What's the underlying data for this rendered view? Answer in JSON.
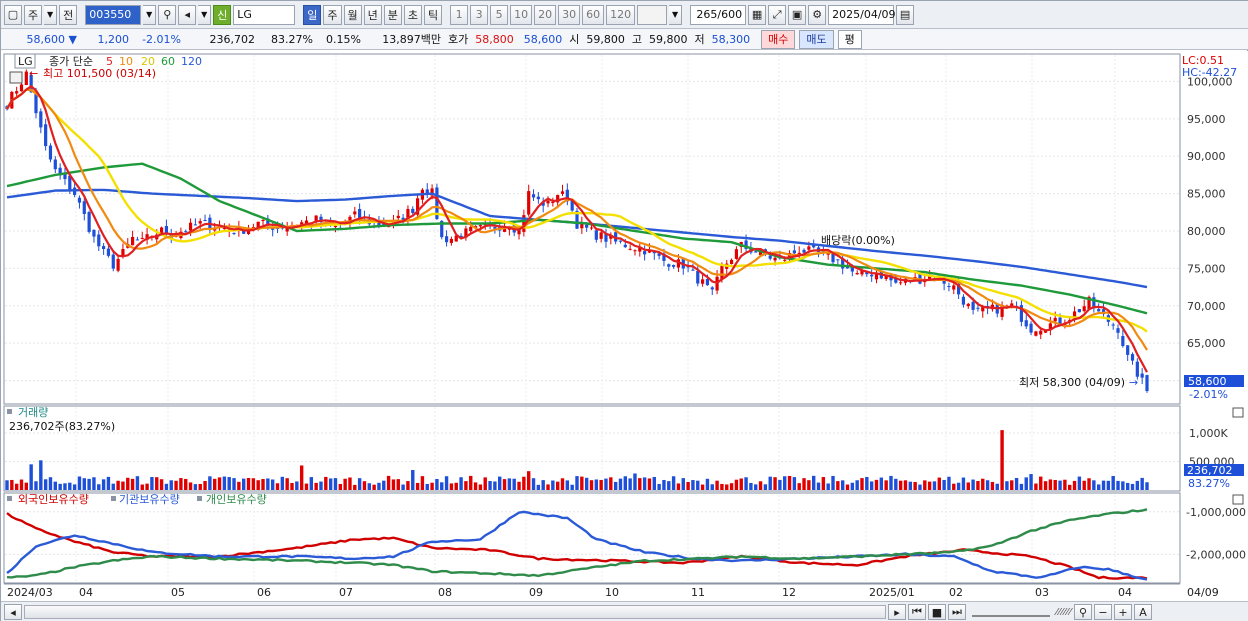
{
  "toolbar": {
    "period_buttons": [
      "주",
      "전"
    ],
    "code": "003550",
    "shin_label": "신",
    "stock_name": "LG",
    "timeframes": [
      "일",
      "주",
      "월",
      "년",
      "분",
      "초",
      "틱"
    ],
    "active_timeframe": "일",
    "intervals": [
      "1",
      "3",
      "5",
      "10",
      "20",
      "30",
      "60",
      "120"
    ],
    "count": "265",
    "count_max": "/600",
    "date": "2025/04/09"
  },
  "quote": {
    "price": "58,600",
    "change": "1,200",
    "change_pct": "-2.01%",
    "volume": "236,702",
    "vol_ratio": "83.27%",
    "turnover": "0.15%",
    "amount": "13,897백만",
    "ask_label": "호가",
    "ask1": "58,800",
    "ask2": "58,600",
    "open_label": "시",
    "open": "59,800",
    "high_label": "고",
    "high": "59,800",
    "low_label": "저",
    "low": "58,300",
    "buy_label": "매수",
    "sell_label": "매도",
    "avg_label": "평"
  },
  "colors": {
    "up": "#e00000",
    "down": "#1d4fd8",
    "ma5": "#e02020",
    "ma10": "#f08a10",
    "ma20": "#f4e000",
    "ma60": "#1e9a3a",
    "ma120": "#2a5ad6"
  },
  "chart_data": [
    {
      "type": "line",
      "legend_stock": "LG",
      "legend_title": "종가 단순",
      "legend_periods": [
        "5",
        "10",
        "20",
        "60",
        "120"
      ],
      "max_label": "최고 101,500 (03/14)",
      "min_label": "최저 58,300 (04/09)",
      "dividend_label": "배당락(0.00%)",
      "lc_label": "LC:0.51",
      "hc_label": "HC:-42.27",
      "last_price_tag": "58,600",
      "last_change_tag": "-2.01%",
      "y_ticks": [
        "100,000",
        "95,000",
        "90,000",
        "85,000",
        "80,000",
        "75,000",
        "70,000",
        "65,000",
        "60,000"
      ],
      "ylim": [
        57000,
        103000
      ],
      "x_labels": [
        "2024/03",
        "04",
        "05",
        "06",
        "07",
        "08",
        "09",
        "10",
        "11",
        "12",
        "2025/01",
        "02",
        "03",
        "04",
        "04/09"
      ],
      "close_anchors": [
        [
          0,
          97000
        ],
        [
          2,
          99000
        ],
        [
          4,
          101000
        ],
        [
          6,
          96000
        ],
        [
          8,
          91000
        ],
        [
          10,
          88000
        ],
        [
          12,
          86500
        ],
        [
          14,
          85000
        ],
        [
          16,
          82000
        ],
        [
          18,
          79000
        ],
        [
          20,
          77000
        ],
        [
          22,
          75500
        ],
        [
          24,
          77000
        ],
        [
          26,
          79000
        ],
        [
          28,
          78500
        ],
        [
          30,
          79500
        ],
        [
          32,
          80000
        ],
        [
          34,
          79500
        ],
        [
          36,
          80000
        ],
        [
          40,
          81000
        ],
        [
          44,
          80500
        ],
        [
          48,
          80000
        ],
        [
          52,
          81000
        ],
        [
          56,
          80500
        ],
        [
          60,
          81000
        ],
        [
          64,
          81500
        ],
        [
          68,
          80500
        ],
        [
          72,
          82000
        ],
        [
          76,
          81000
        ],
        [
          80,
          81000
        ],
        [
          84,
          83000
        ],
        [
          86,
          86000
        ],
        [
          88,
          85000
        ],
        [
          90,
          79000
        ],
        [
          92,
          79000
        ],
        [
          96,
          80000
        ],
        [
          100,
          80500
        ],
        [
          104,
          81000
        ],
        [
          106,
          80000
        ],
        [
          108,
          85000
        ],
        [
          110,
          84000
        ],
        [
          112,
          83500
        ],
        [
          114,
          85000
        ],
        [
          116,
          84500
        ],
        [
          118,
          81000
        ],
        [
          122,
          79500
        ],
        [
          126,
          78500
        ],
        [
          132,
          77500
        ],
        [
          136,
          76000
        ],
        [
          140,
          75500
        ],
        [
          144,
          73000
        ],
        [
          146,
          71500
        ],
        [
          148,
          75000
        ],
        [
          152,
          78000
        ],
        [
          156,
          77000
        ],
        [
          160,
          76000
        ],
        [
          164,
          77500
        ],
        [
          168,
          77000
        ],
        [
          172,
          76000
        ],
        [
          176,
          74000
        ],
        [
          180,
          74500
        ],
        [
          184,
          73000
        ],
        [
          188,
          73500
        ],
        [
          192,
          74000
        ],
        [
          196,
          72500
        ],
        [
          200,
          69000
        ],
        [
          204,
          69500
        ],
        [
          208,
          70000
        ],
        [
          212,
          67000
        ],
        [
          216,
          67500
        ],
        [
          220,
          68500
        ],
        [
          224,
          70500
        ],
        [
          226,
          69000
        ],
        [
          230,
          67000
        ],
        [
          232,
          63000
        ],
        [
          234,
          61000
        ],
        [
          236,
          58600
        ]
      ],
      "ma60_anchors": [
        [
          0,
          86000
        ],
        [
          10,
          87500
        ],
        [
          20,
          88500
        ],
        [
          28,
          89000
        ],
        [
          36,
          87000
        ],
        [
          44,
          84000
        ],
        [
          52,
          82000
        ],
        [
          60,
          80000
        ],
        [
          70,
          80300
        ],
        [
          80,
          80800
        ],
        [
          90,
          81000
        ],
        [
          100,
          81000
        ],
        [
          110,
          81500
        ],
        [
          120,
          81000
        ],
        [
          130,
          80000
        ],
        [
          140,
          79000
        ],
        [
          150,
          78500
        ],
        [
          160,
          76500
        ],
        [
          170,
          75500
        ],
        [
          180,
          75000
        ],
        [
          190,
          74500
        ],
        [
          200,
          73500
        ],
        [
          210,
          72700
        ],
        [
          220,
          71500
        ],
        [
          230,
          70000
        ],
        [
          236,
          69000
        ]
      ],
      "ma120_anchors": [
        [
          0,
          84500
        ],
        [
          10,
          85400
        ],
        [
          20,
          85500
        ],
        [
          30,
          85000
        ],
        [
          40,
          84700
        ],
        [
          50,
          84400
        ],
        [
          60,
          84000
        ],
        [
          70,
          84200
        ],
        [
          80,
          84700
        ],
        [
          88,
          85000
        ],
        [
          100,
          82000
        ],
        [
          110,
          81500
        ],
        [
          120,
          81000
        ],
        [
          130,
          80400
        ],
        [
          140,
          79800
        ],
        [
          150,
          79200
        ],
        [
          160,
          78700
        ],
        [
          170,
          78000
        ],
        [
          180,
          77300
        ],
        [
          190,
          76700
        ],
        [
          200,
          76000
        ],
        [
          210,
          75200
        ],
        [
          220,
          74200
        ],
        [
          230,
          73200
        ],
        [
          236,
          72500
        ]
      ]
    },
    {
      "type": "bar",
      "title": "거래량",
      "current_label": "236,702주(83.27%)",
      "y_ticks": [
        "1,000K",
        "500,000"
      ],
      "ylim": [
        0,
        1350000
      ],
      "last_tag": "236,702",
      "last_tag2": "83.27%",
      "spikes": [
        [
          5,
          450000
        ],
        [
          7,
          520000
        ],
        [
          61,
          430000
        ],
        [
          84,
          350000
        ],
        [
          108,
          330000
        ],
        [
          130,
          290000
        ],
        [
          206,
          1050000
        ],
        [
          212,
          280000
        ]
      ]
    },
    {
      "type": "line",
      "legend": [
        "외국인보유수량",
        "기관보유수량",
        "개인보유수량"
      ],
      "y_ticks": [
        "-1,000,000",
        "-2,000,000"
      ],
      "ylim": [
        -2650000,
        -700000
      ],
      "series": [
        {
          "name": "외국인보유수량",
          "color": "#d00000",
          "anchors": [
            [
              0,
              -1050000
            ],
            [
              6,
              -1400000
            ],
            [
              14,
              -1700000
            ],
            [
              22,
              -1950000
            ],
            [
              30,
              -2050000
            ],
            [
              44,
              -2050000
            ],
            [
              60,
              -1850000
            ],
            [
              72,
              -1650000
            ],
            [
              80,
              -1620000
            ],
            [
              88,
              -1850000
            ],
            [
              100,
              -1900000
            ],
            [
              110,
              -2100000
            ],
            [
              126,
              -2150000
            ],
            [
              140,
              -2200000
            ],
            [
              152,
              -2050000
            ],
            [
              164,
              -2200000
            ],
            [
              176,
              -2250000
            ],
            [
              186,
              -2050000
            ],
            [
              198,
              -1900000
            ],
            [
              212,
              -2050000
            ],
            [
              220,
              -2300000
            ],
            [
              226,
              -2550000
            ],
            [
              236,
              -2550000
            ]
          ]
        },
        {
          "name": "기관보유수량",
          "color": "#2a5ad6",
          "anchors": [
            [
              0,
              -2450000
            ],
            [
              6,
              -1800000
            ],
            [
              14,
              -1550000
            ],
            [
              22,
              -1750000
            ],
            [
              30,
              -1950000
            ],
            [
              44,
              -2050000
            ],
            [
              60,
              -2050000
            ],
            [
              72,
              -2100000
            ],
            [
              80,
              -2050000
            ],
            [
              88,
              -1700000
            ],
            [
              98,
              -1650000
            ],
            [
              106,
              -1000000
            ],
            [
              116,
              -1150000
            ],
            [
              122,
              -1650000
            ],
            [
              132,
              -1950000
            ],
            [
              142,
              -2100000
            ],
            [
              152,
              -2150000
            ],
            [
              164,
              -2100000
            ],
            [
              176,
              -2050000
            ],
            [
              186,
              -2000000
            ],
            [
              196,
              -2050000
            ],
            [
              204,
              -2400000
            ],
            [
              214,
              -2550000
            ],
            [
              222,
              -2300000
            ],
            [
              228,
              -2350000
            ],
            [
              236,
              -2600000
            ]
          ]
        },
        {
          "name": "개인보유수량",
          "color": "#2e8b4a",
          "anchors": [
            [
              0,
              -2550000
            ],
            [
              6,
              -2500000
            ],
            [
              14,
              -2300000
            ],
            [
              22,
              -2150000
            ],
            [
              30,
              -2050000
            ],
            [
              44,
              -2100000
            ],
            [
              60,
              -2150000
            ],
            [
              72,
              -2200000
            ],
            [
              80,
              -2250000
            ],
            [
              88,
              -2400000
            ],
            [
              100,
              -2450000
            ],
            [
              110,
              -2500000
            ],
            [
              122,
              -2300000
            ],
            [
              132,
              -2150000
            ],
            [
              144,
              -2100000
            ],
            [
              152,
              -2050000
            ],
            [
              164,
              -2100000
            ],
            [
              176,
              -2050000
            ],
            [
              186,
              -2000000
            ],
            [
              196,
              -1950000
            ],
            [
              204,
              -1800000
            ],
            [
              212,
              -1450000
            ],
            [
              220,
              -1200000
            ],
            [
              228,
              -1050000
            ],
            [
              236,
              -950000
            ]
          ]
        }
      ],
      "last_tag": "-"
    }
  ],
  "ui": {
    "x_axis_end": "04/09"
  }
}
